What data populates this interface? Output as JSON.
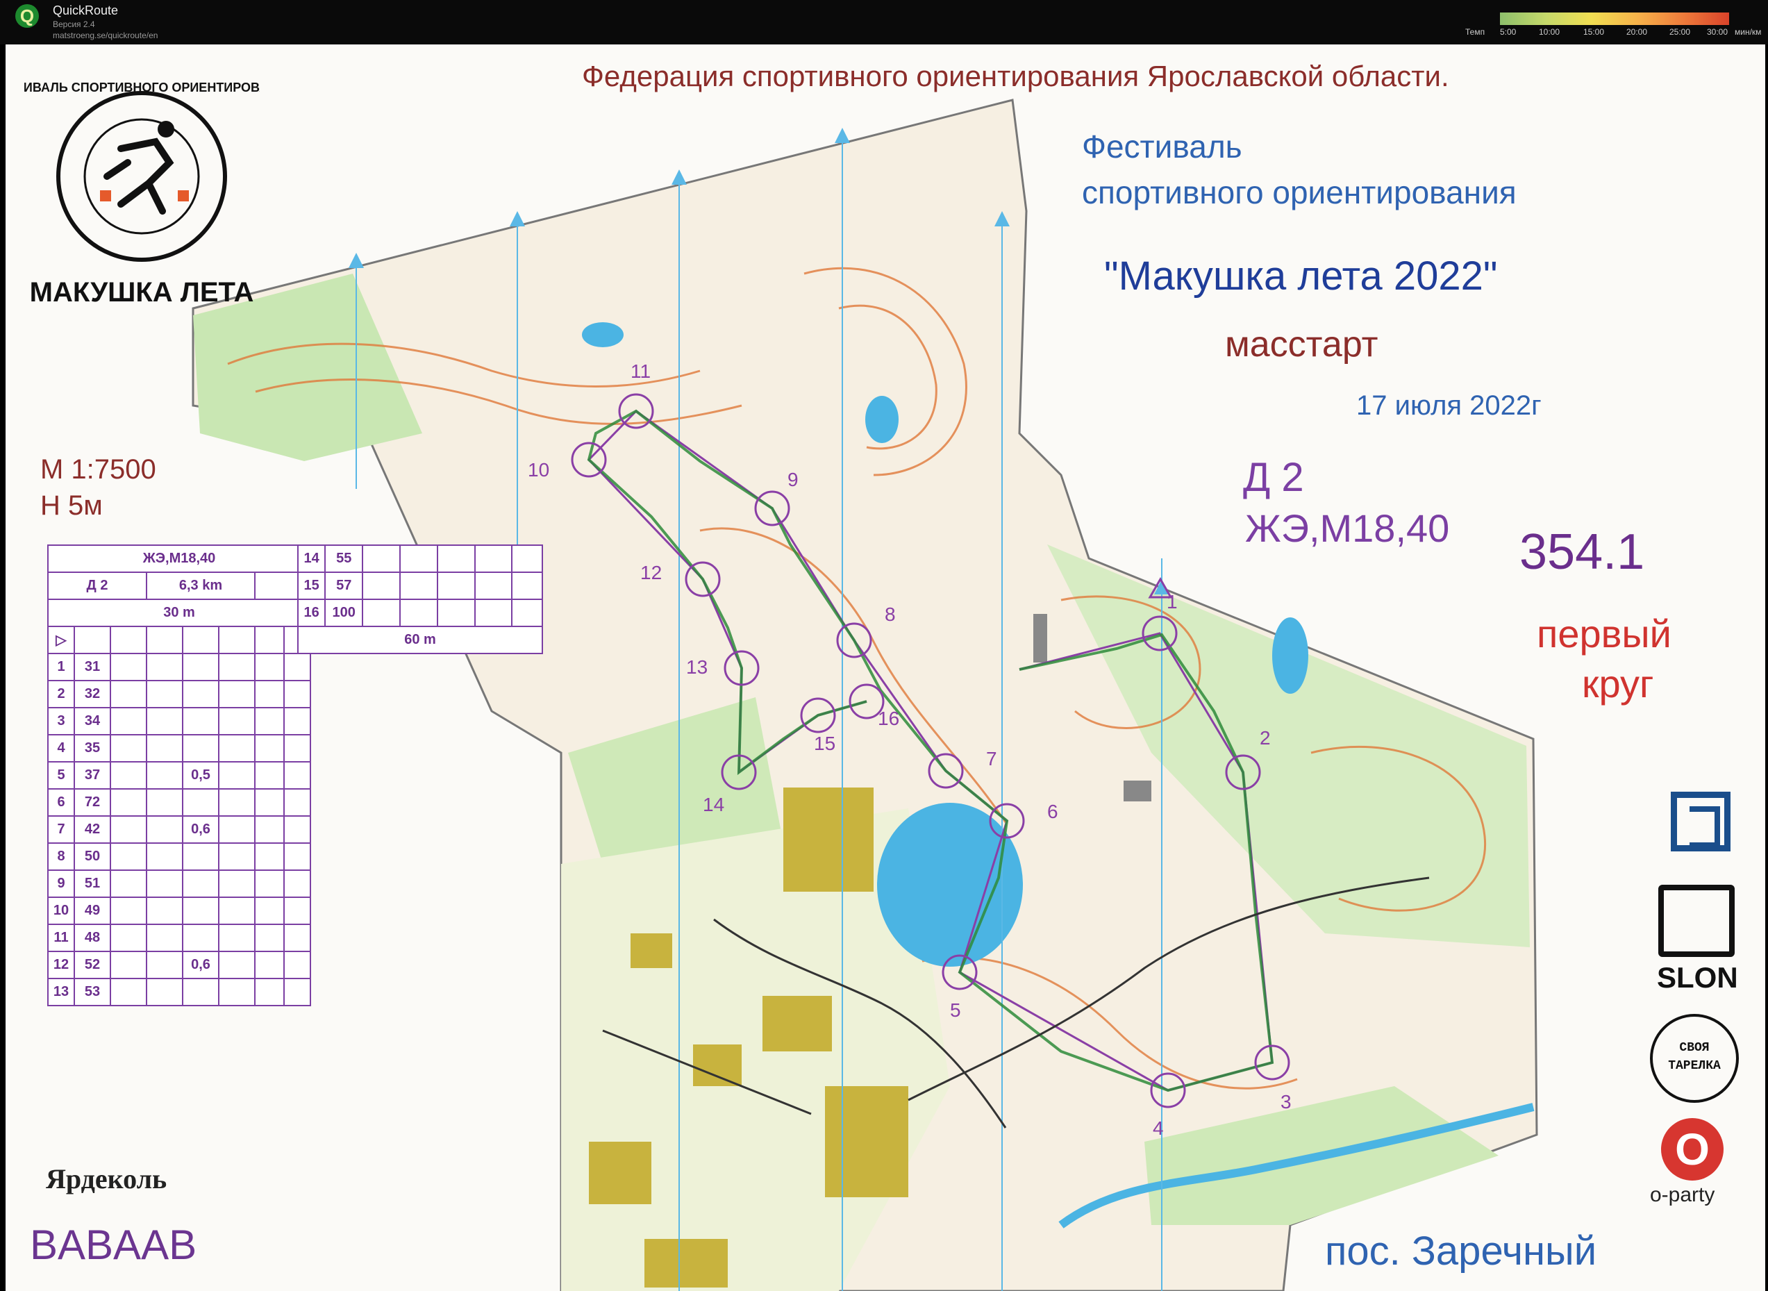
{
  "app": {
    "title": "QuickRoute",
    "version": "Версия 2.4",
    "url": "matstroeng.se/quickroute/en",
    "logo_letter": "Q"
  },
  "pace_scale": {
    "label_title": "Темп",
    "ticks": [
      "5:00",
      "10:00",
      "15:00",
      "20:00",
      "25:00",
      "30:00"
    ],
    "unit": "мин/км",
    "colors": [
      "#8dbf6b",
      "#c5d96a",
      "#f1de52",
      "#f6b24a",
      "#ee7b3b",
      "#d9432a"
    ]
  },
  "map": {
    "federation": "Федерация спортивного ориентирования Ярославской области.",
    "festival_line1": "Фестиваль",
    "festival_line2": "спортивного ориентирования",
    "event_name": "\"Макушка лета 2022\"",
    "format": "масстарт",
    "date": "17 июля 2022г",
    "course": "Д 2",
    "classes": "ЖЭ,М18,40",
    "bib": "354.1",
    "lap_line1": "первый",
    "lap_line2": "круг",
    "scale": "М  1:7500",
    "contour": "Н   5м",
    "runner": "BABAAB",
    "village": "пос. Заречный",
    "logo_ring_text": "ФЕСТИВАЛЬ СПОРТИВНОГО ОРИЕНТИРОВАНИЯ",
    "logo_bottom_text": "МАКУШКА ЛЕТА",
    "yardkol": "Ярдеколь",
    "sponsor_slon": "SLON",
    "sponsor_plate": "СВОЯ ТАРЕЛКА",
    "sponsor_oparty_letter": "O",
    "sponsor_oparty": "o-party",
    "control_numbers": [
      "1",
      "2",
      "3",
      "4",
      "5",
      "6",
      "7",
      "8",
      "9",
      "10",
      "11",
      "12",
      "13",
      "14",
      "15",
      "16"
    ]
  },
  "descriptions": {
    "header_classes": "ЖЭ,М18,40",
    "course": "Д 2",
    "length": "6,3 km",
    "start_tape": "30 m",
    "finish_tape": "60 m",
    "rows": [
      {
        "n": "1",
        "code": "31",
        "extra": ""
      },
      {
        "n": "2",
        "code": "32",
        "extra": ""
      },
      {
        "n": "3",
        "code": "34",
        "extra": ""
      },
      {
        "n": "4",
        "code": "35",
        "extra": ""
      },
      {
        "n": "5",
        "code": "37",
        "extra": "0,5"
      },
      {
        "n": "6",
        "code": "72",
        "extra": ""
      },
      {
        "n": "7",
        "code": "42",
        "extra": "0,6"
      },
      {
        "n": "8",
        "code": "50",
        "extra": ""
      },
      {
        "n": "9",
        "code": "51",
        "extra": ""
      },
      {
        "n": "10",
        "code": "49",
        "extra": ""
      },
      {
        "n": "11",
        "code": "48",
        "extra": ""
      },
      {
        "n": "12",
        "code": "52",
        "extra": "0,6"
      },
      {
        "n": "13",
        "code": "53",
        "extra": ""
      }
    ],
    "rows2": [
      {
        "n": "14",
        "code": "55"
      },
      {
        "n": "15",
        "code": "57"
      },
      {
        "n": "16",
        "code": "100"
      }
    ]
  }
}
